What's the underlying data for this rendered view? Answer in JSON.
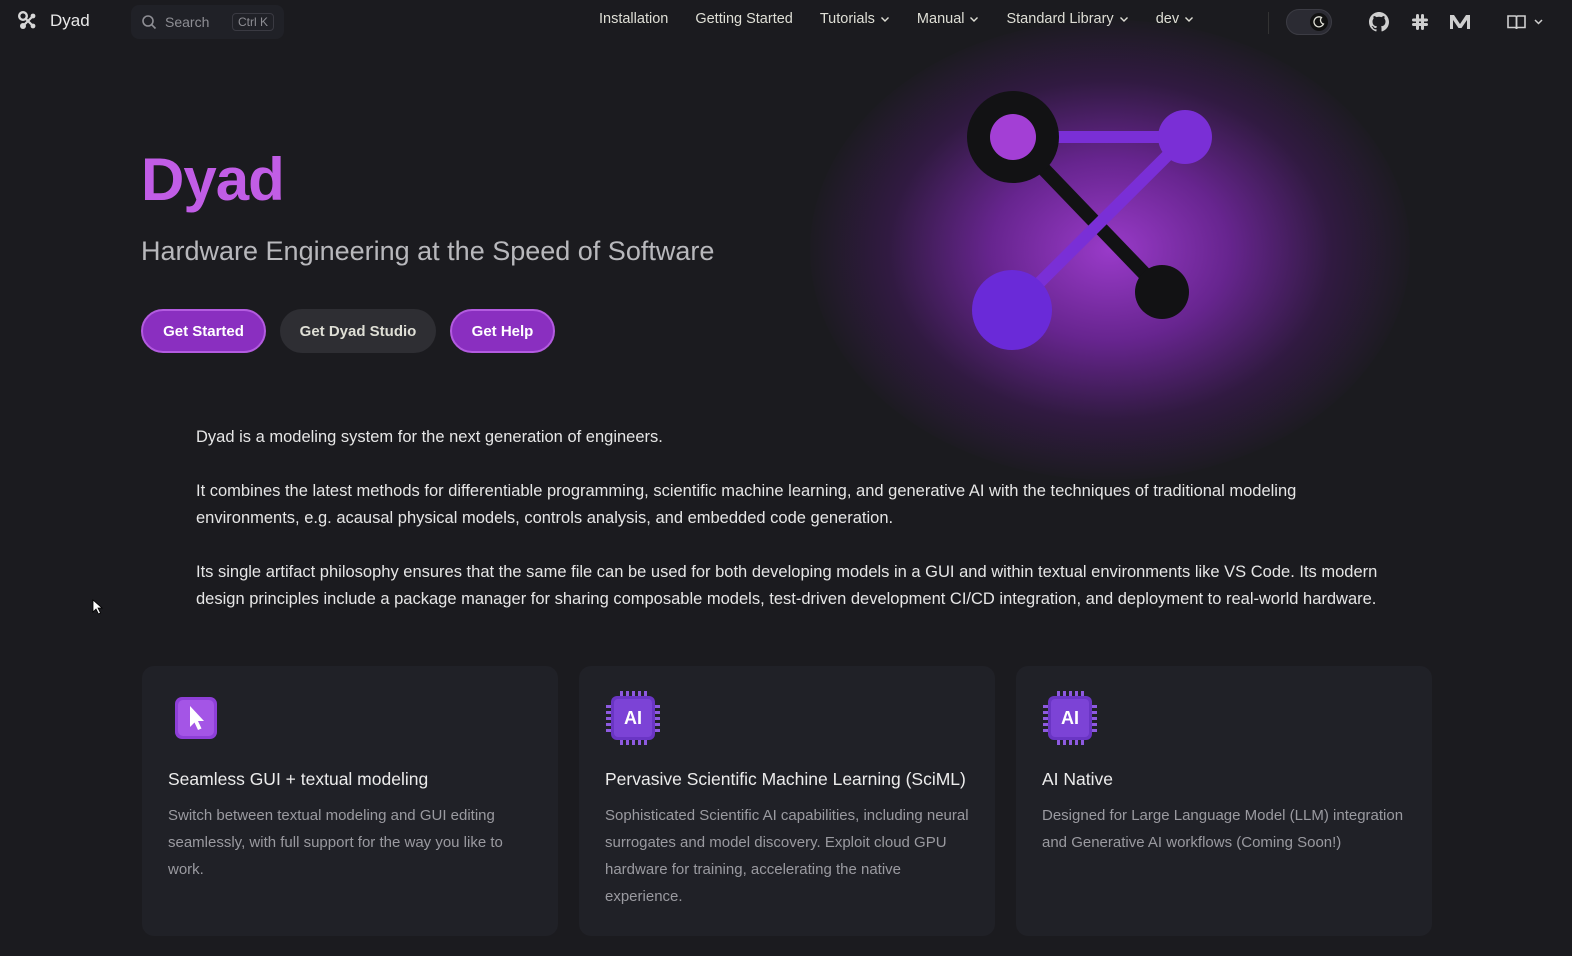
{
  "nav": {
    "brand": "Dyad",
    "search_placeholder": "Search",
    "search_shortcut": "Ctrl K",
    "items": [
      {
        "label": "Installation"
      },
      {
        "label": "Getting Started"
      },
      {
        "label": "Tutorials"
      },
      {
        "label": "Manual"
      },
      {
        "label": "Standard Library"
      },
      {
        "label": "dev"
      }
    ],
    "social_icons": [
      "github-icon",
      "slack-icon",
      "medium-icon"
    ],
    "extra_icon": "book-icon"
  },
  "hero": {
    "title": "Dyad",
    "tagline": "Hardware Engineering at the Speed of Software",
    "actions": [
      {
        "label": "Get Started"
      },
      {
        "label": "Get Dyad Studio"
      },
      {
        "label": "Get Help"
      }
    ]
  },
  "intro": [
    "Dyad is a modeling system for the next generation of engineers.",
    "It combines the latest methods for differentiable programming, scientific machine learning, and generative AI with the techniques of traditional modeling environments, e.g. acausal physical models, controls analysis, and embedded code generation.",
    "Its single artifact philosophy ensures that the same file can be used for both developing models in a GUI and within textual environments like VS Code. Its modern design principles include a package manager for sharing composable models, test-driven development CI/CD integration, and deployment to real-world hardware."
  ],
  "features": [
    {
      "icon": "cursor-icon",
      "title": "Seamless GUI + textual modeling",
      "details": "Switch between textual modeling and GUI editing seamlessly, with full support for the way you like to work."
    },
    {
      "icon": "ai-chip-icon",
      "icon_label": "AI",
      "title": "Pervasive Scientific Machine Learning (SciML)",
      "details": "Sophisticated Scientific AI capabilities, including neural surrogates and model discovery. Exploit cloud GPU hardware for training, accelerating the native experience."
    },
    {
      "icon": "ai-chip-icon",
      "icon_label": "AI",
      "title": "AI Native",
      "details": "Designed for Large Language Model (LLM) integration and Generative AI workflows (Coming Soon!)"
    }
  ],
  "colors": {
    "background": "#1b1b1f",
    "brand": "#c15de6",
    "button": "#8a2fc0",
    "card": "#202127"
  }
}
